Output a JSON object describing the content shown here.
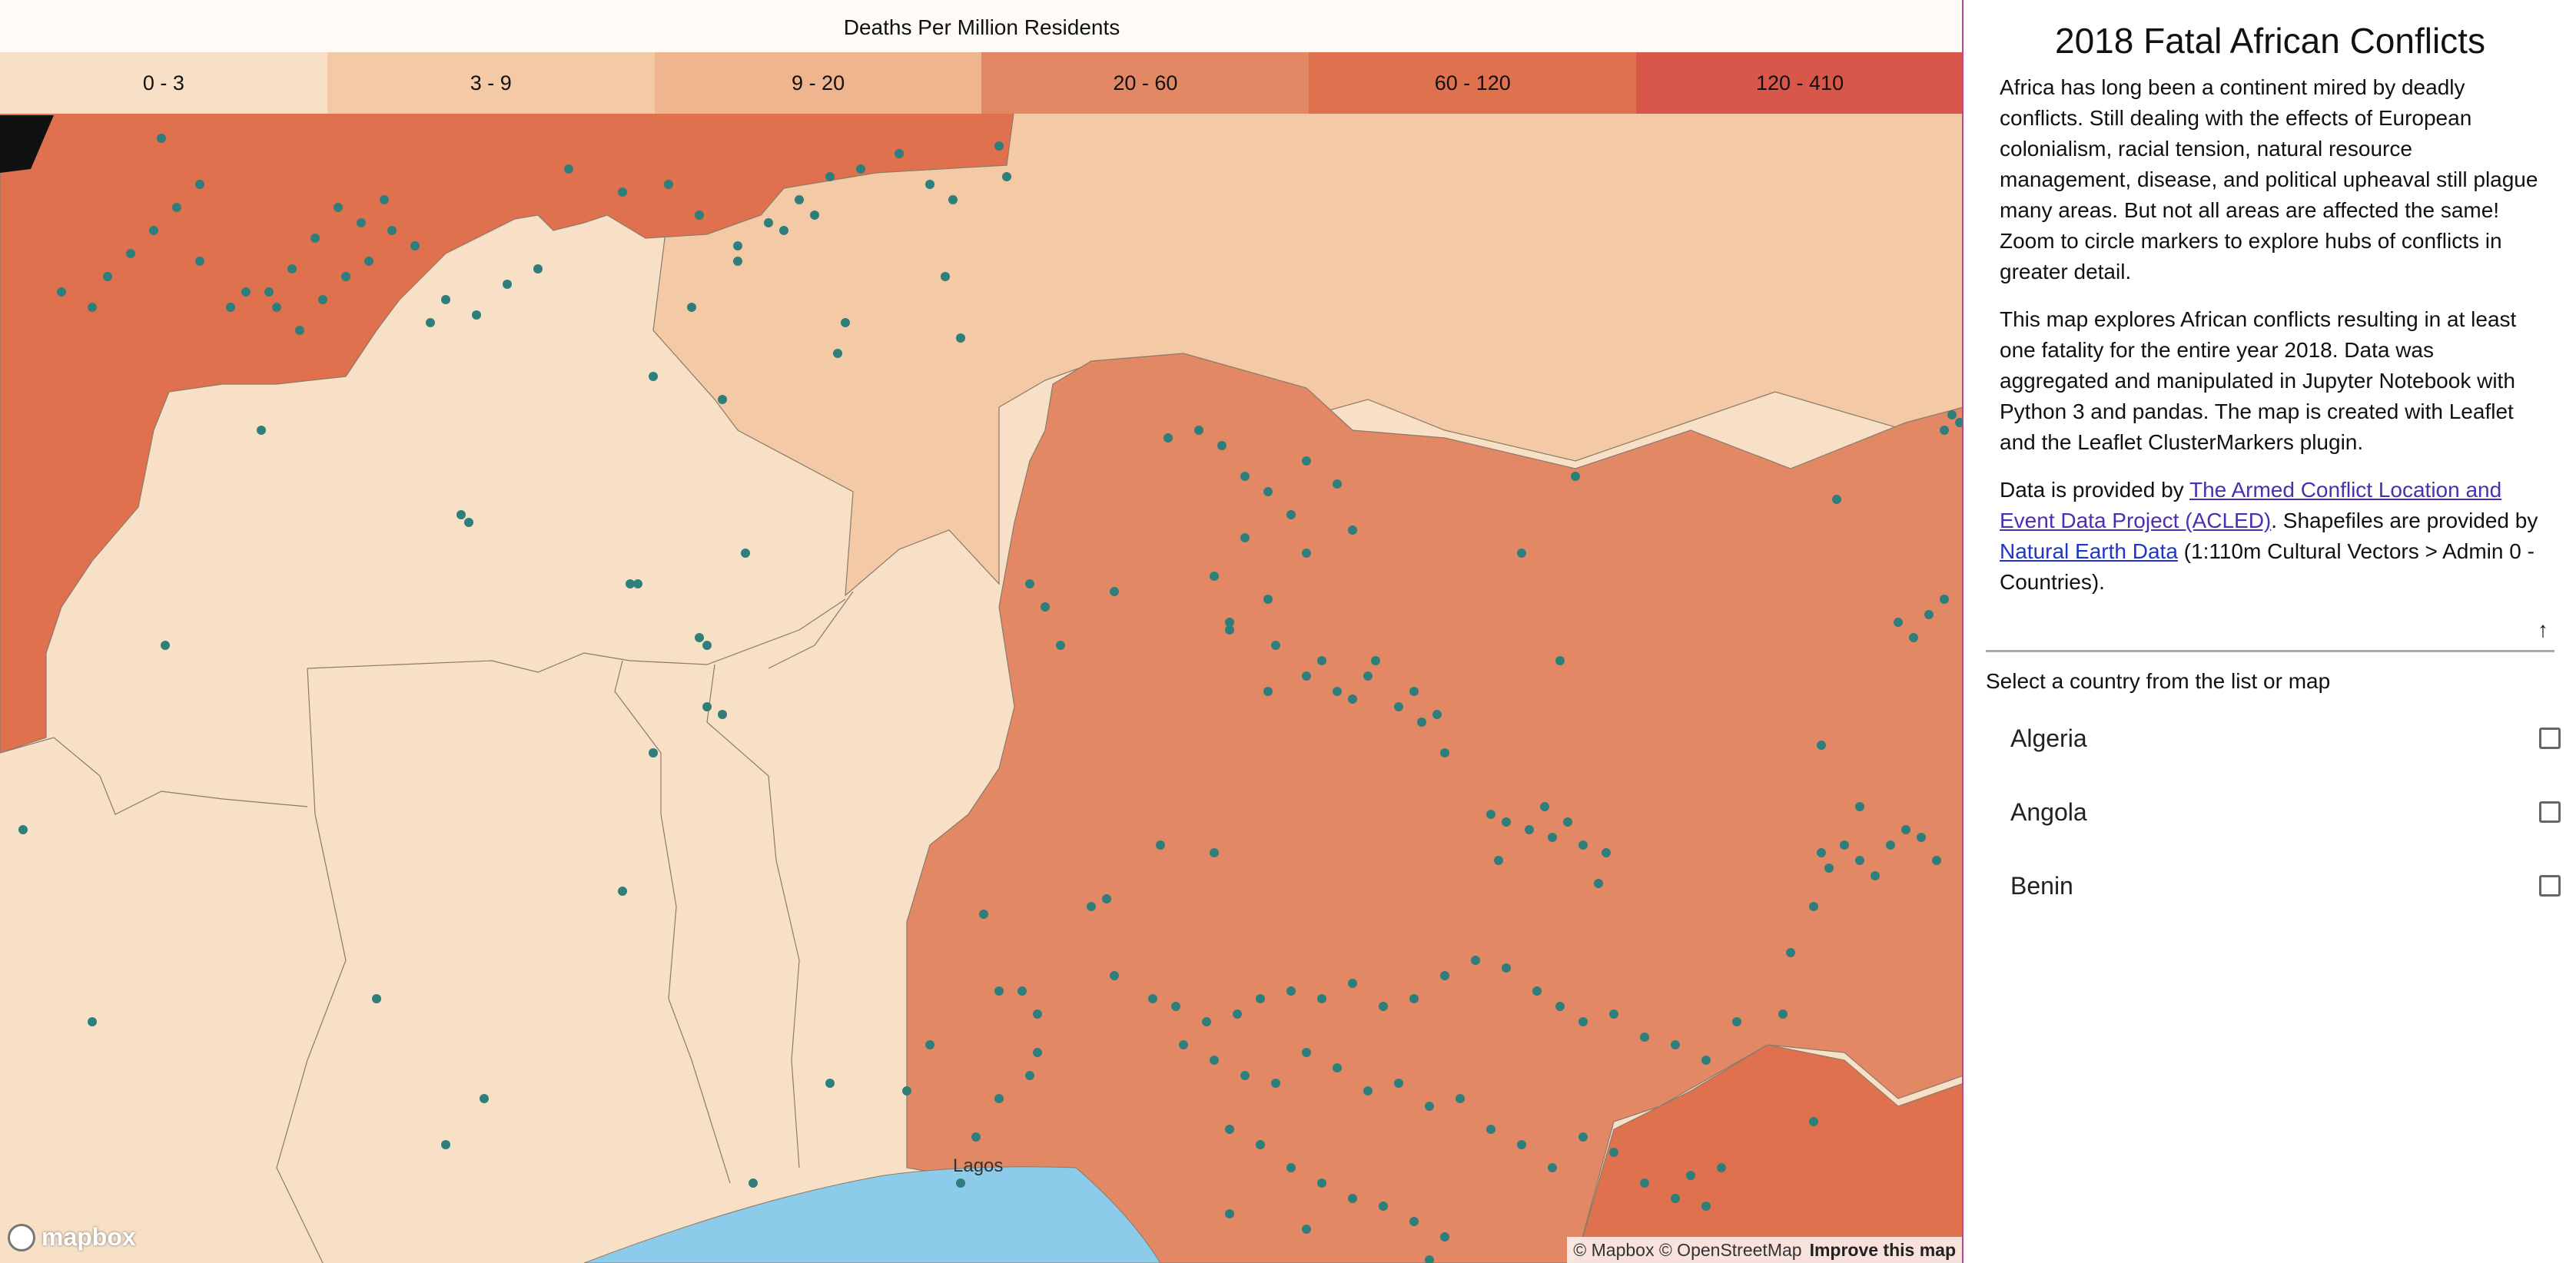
{
  "map": {
    "legend": {
      "title": "Deaths Per Million Residents",
      "bins": [
        {
          "label": "0 - 3",
          "color": "#f8e0c6"
        },
        {
          "label": "3 - 9",
          "color": "#f3c9a6"
        },
        {
          "label": "9 - 20",
          "color": "#efb58f"
        },
        {
          "label": "20 - 60",
          "color": "#e38865"
        },
        {
          "label": "60 - 120",
          "color": "#e0714f"
        },
        {
          "label": "120 - 410",
          "color": "#d9574a"
        }
      ]
    },
    "water_color": "#8ccbea",
    "marker_color": "#2e7f7b",
    "place_label": "Lagos",
    "logo_text": "mapbox",
    "attribution": {
      "text": "© Mapbox © OpenStreetMap",
      "improve": "Improve this map"
    }
  },
  "sidebar": {
    "title": "2018 Fatal African Conflicts",
    "intro": "Africa has long been a continent mired by deadly conflicts. Still dealing with the effects of European colonialism, racial tension, natural resource management, disease, and political upheaval still plague many areas. But not all areas are affected the same! Zoom to circle markers to explore hubs of conflicts in greater detail.",
    "about": "This map explores African conflicts resulting in at least one fatality for the entire year 2018. Data was aggregated and manipulated in Jupyter Notebook with Python 3 and pandas. The map is created with Leaflet and the Leaflet ClusterMarkers plugin.",
    "data_prefix": "Data is provided by ",
    "acled_link": "The Armed Conflict Location and Event Data Project (ACLED)",
    "shapefile_text": ". Shapefiles are provided by ",
    "ne_link": "Natural Earth Data",
    "ne_suffix": " (1:110m Cultural Vectors > Admin 0 - Countries).",
    "collapse_icon": "arrow-up-icon",
    "select_prompt": "Select a country from the list or map",
    "countries": [
      {
        "name": "Algeria",
        "checked": false
      },
      {
        "name": "Angola",
        "checked": false
      },
      {
        "name": "Benin",
        "checked": false
      }
    ]
  }
}
